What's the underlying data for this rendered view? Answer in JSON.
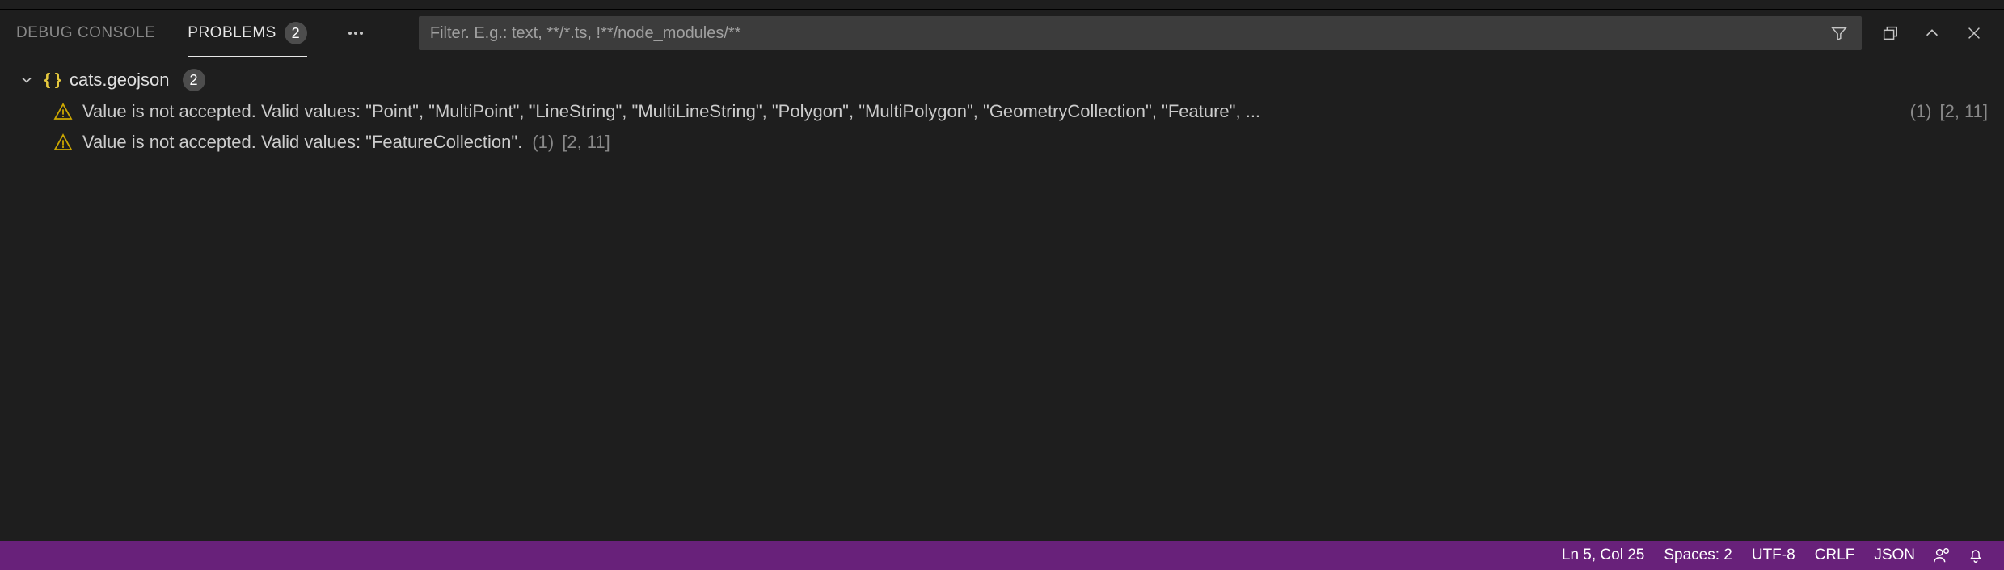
{
  "tabs": {
    "debug_console": "DEBUG CONSOLE",
    "problems": {
      "label": "PROBLEMS",
      "count": "2"
    }
  },
  "filter": {
    "placeholder": "Filter. E.g.: text, **/*.ts, !**/node_modules/**"
  },
  "file": {
    "name": "cats.geojson",
    "count": "2",
    "icon": "{ }"
  },
  "problems": [
    {
      "message": "Value is not accepted. Valid values: \"Point\", \"MultiPoint\", \"LineString\", \"MultiLineString\", \"Polygon\", \"MultiPolygon\", \"GeometryCollection\", \"Feature\", ...",
      "source": "(1)",
      "location": "[2, 11]"
    },
    {
      "message": "Value is not accepted. Valid values: \"FeatureCollection\".",
      "source": "(1)",
      "location": "[2, 11]"
    }
  ],
  "status": {
    "ln_col": "Ln 5, Col 25",
    "spaces": "Spaces: 2",
    "encoding": "UTF-8",
    "eol": "CRLF",
    "language": "JSON"
  }
}
